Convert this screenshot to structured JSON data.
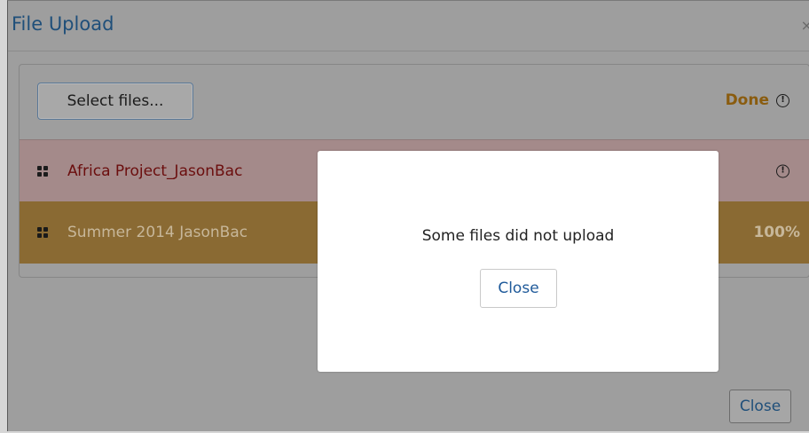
{
  "dialog": {
    "title": "File Upload",
    "close_glyph": "×",
    "close_icon": "close-icon"
  },
  "upload": {
    "select_label": "Select files...",
    "status_label": "Done",
    "status_icon": "warning-circle-icon",
    "files": [
      {
        "name": "Africa Project_JasonBac",
        "state": "error",
        "status_icon": "warning-circle-icon"
      },
      {
        "name": "Summer 2014 JasonBac",
        "state": "uploaded",
        "progress_text": "100%"
      }
    ]
  },
  "footer": {
    "close_label": "Close"
  },
  "popup": {
    "message": "Some files did not upload",
    "close_label": "Close"
  },
  "colors": {
    "title": "#1f4f7a",
    "done": "#8a5c0f",
    "error_row_bg": "#a48a8a",
    "error_text": "#6b0e0e",
    "success_row_bg": "#8a6a33",
    "success_text": "#c7b79a",
    "link_blue": "#1f5a9a"
  }
}
